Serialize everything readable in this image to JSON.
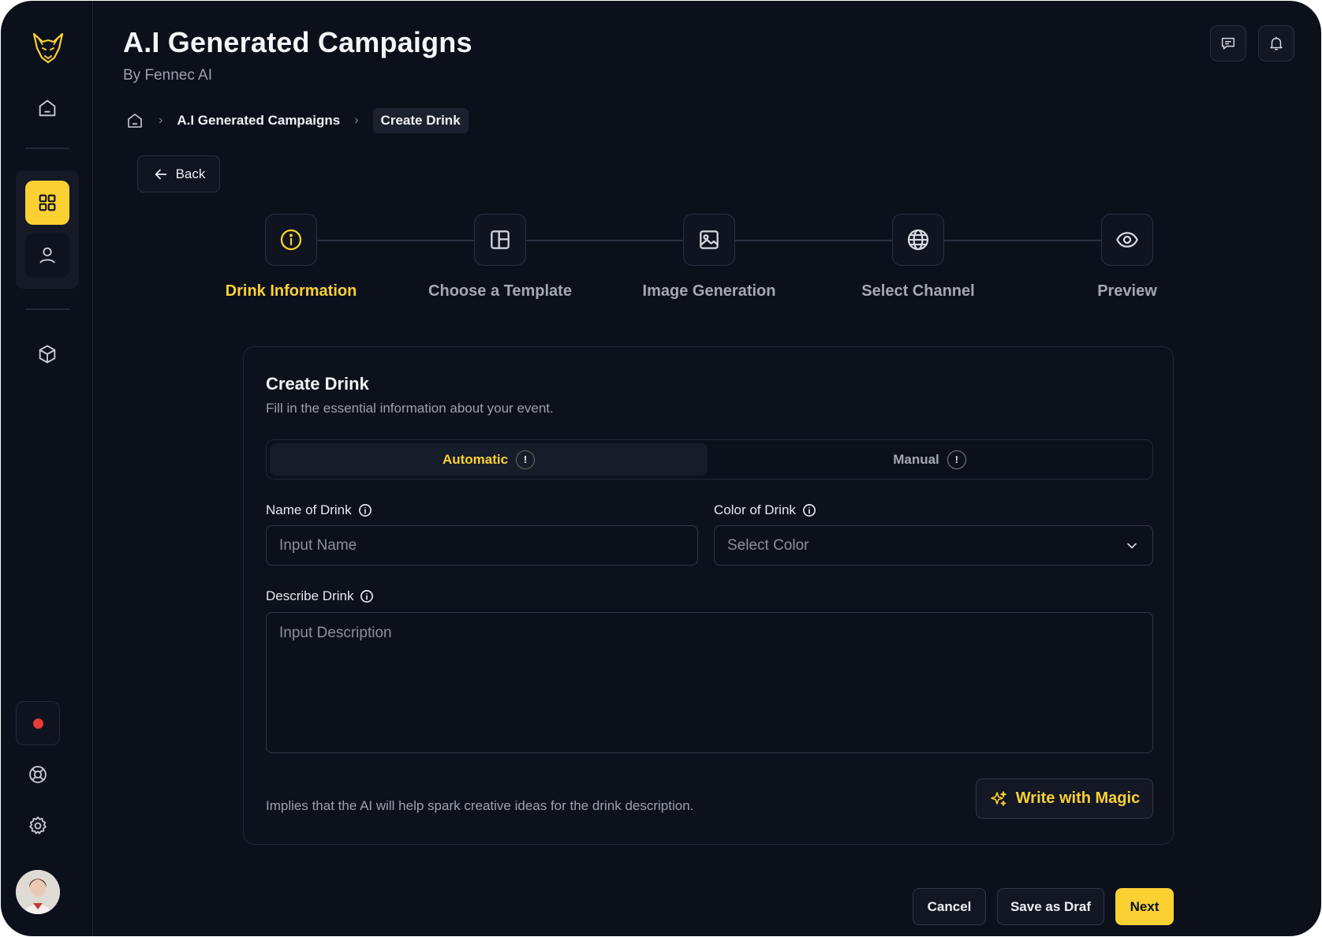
{
  "header": {
    "title": "A.I Generated Campaigns",
    "subtitle": "By Fennec AI"
  },
  "breadcrumb": {
    "items": [
      "A.I Generated Campaigns",
      "Create Drink"
    ]
  },
  "back": {
    "label": "Back"
  },
  "stepper": {
    "active_index": 0,
    "steps": [
      {
        "label": "Drink Information",
        "icon": "info-icon"
      },
      {
        "label": "Choose a Template",
        "icon": "layout-icon"
      },
      {
        "label": "Image Generation",
        "icon": "image-icon"
      },
      {
        "label": "Select Channel",
        "icon": "globe-icon"
      },
      {
        "label": "Preview",
        "icon": "eye-icon"
      }
    ]
  },
  "form": {
    "title": "Create Drink",
    "description": "Fill in the essential information about your event.",
    "modes": {
      "automatic": "Automatic",
      "manual": "Manual",
      "selected": "Automatic",
      "badge": "!"
    },
    "name_label": "Name of Drink",
    "name_placeholder": "Input Name",
    "color_label": "Color of Drink",
    "color_placeholder": "Select Color",
    "describe_label": "Describe Drink",
    "describe_placeholder": "Input Description",
    "hint": "Implies that the AI will help spark creative ideas for the drink description.",
    "magic_label": "Write with Magic"
  },
  "footer": {
    "cancel": "Cancel",
    "save_draft": "Save as Draf",
    "next": "Next"
  },
  "colors": {
    "accent": "#fbd033",
    "background": "#0c101b",
    "record": "#e83a36"
  }
}
